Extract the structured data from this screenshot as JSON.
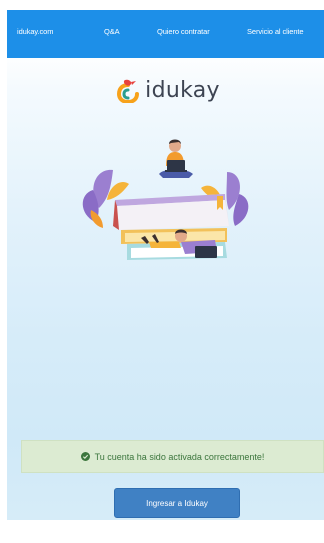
{
  "navbar": {
    "items": [
      {
        "label": "idukay.com"
      },
      {
        "label": "Q&A"
      },
      {
        "label": "Quiero contratar"
      },
      {
        "label": "Servicio al cliente"
      }
    ]
  },
  "logo": {
    "text": "idukay"
  },
  "alert": {
    "message": "Tu cuenta ha sido activada correctamente!",
    "icon": "check-circle-icon"
  },
  "cta": {
    "label": "Ingresar a Idukay"
  },
  "colors": {
    "navbar": "#1d8fe8",
    "button": "#4081c4",
    "alert_bg": "#dcebd2",
    "alert_text": "#3c763d"
  }
}
